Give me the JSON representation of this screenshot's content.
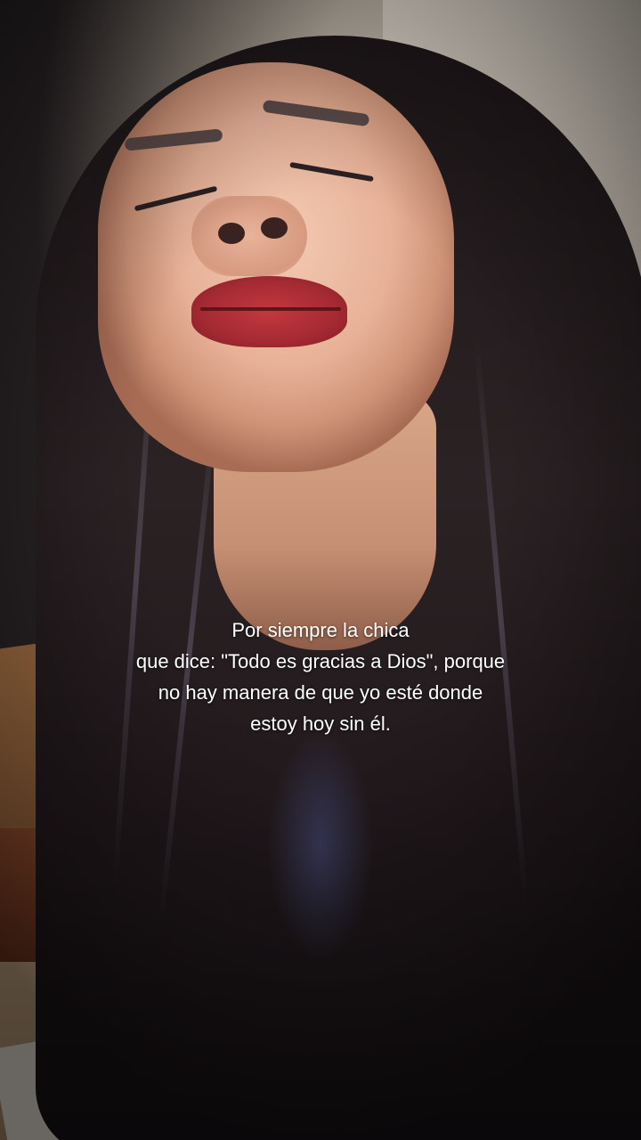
{
  "caption": {
    "lines": [
      "Por siempre la chica",
      "que dice: \"Todo es gracias a Dios\", porque",
      "no hay manera de que yo esté donde",
      "estoy hoy sin él."
    ]
  },
  "colors": {
    "caption_text": "#ffffff",
    "hair": "#22191c",
    "lips": "#a52a33"
  }
}
